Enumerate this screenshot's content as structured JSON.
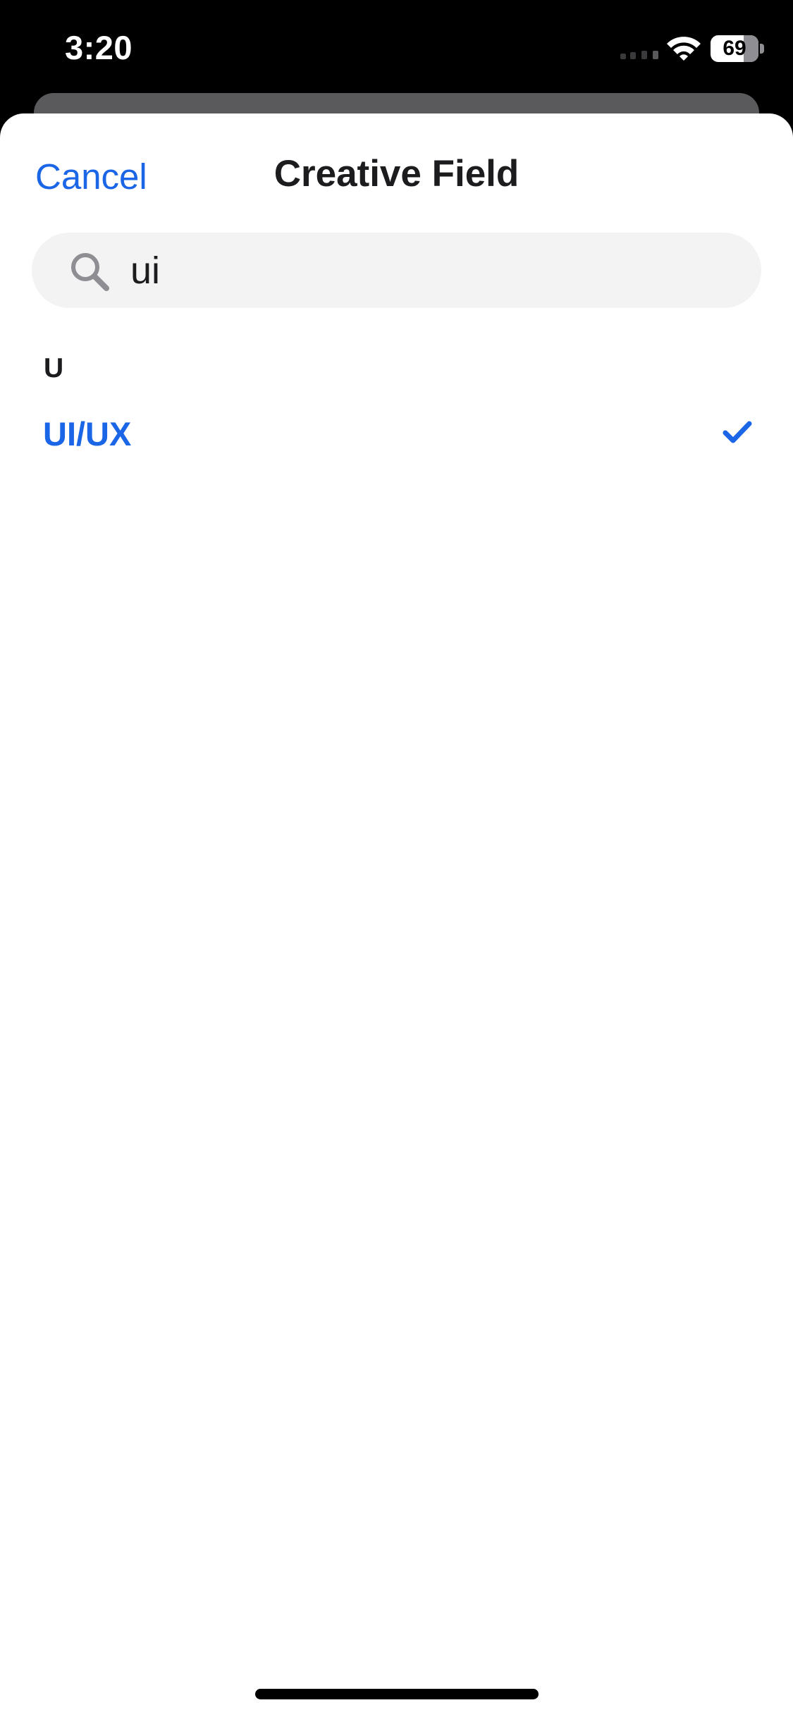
{
  "status_bar": {
    "time": "3:20",
    "battery_level": "69",
    "battery_fraction": 0.69,
    "icons": [
      "cellular-signal-icon",
      "wifi-icon",
      "battery-icon"
    ]
  },
  "sheet": {
    "cancel_label": "Cancel",
    "title": "Creative Field"
  },
  "search": {
    "value": "ui",
    "icon": "search-icon"
  },
  "results": {
    "section_header": "U",
    "items": [
      {
        "label": "UI/UX",
        "selected": true,
        "icon": "checkmark-icon"
      }
    ]
  },
  "colors": {
    "accent": "#1a66e6",
    "text": "#1c1c1e",
    "search_bg": "#f3f3f4",
    "search_icon": "#8e8e93",
    "background": "#ffffff",
    "status_bar_bg": "#000000"
  }
}
